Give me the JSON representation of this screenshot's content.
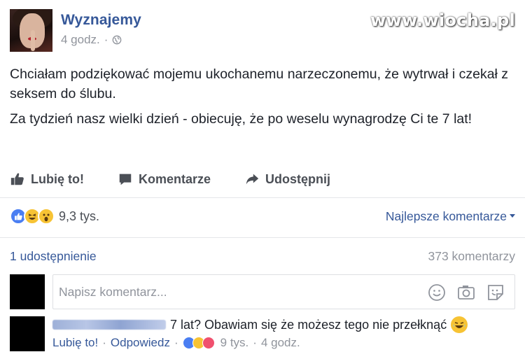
{
  "post": {
    "page_name": "Wyznajemy",
    "time": "4 godz.",
    "separator": "·",
    "paragraphs": [
      "Chciałam podziękować mojemu ukochanemu narzeczonemu, że wytrwał i czekał z seksem do ślubu.",
      "Za tydzień nasz wielki dzień - obiecuję, że po weselu wynagrodzę Ci te 7 lat!"
    ]
  },
  "watermark": "www.wiocha.pl",
  "actions": {
    "like": "Lubię to!",
    "comment": "Komentarze",
    "share": "Udostępnij"
  },
  "reactions": {
    "count": "9,3 tys.",
    "icons": [
      "like-icon",
      "haha-icon",
      "wow-icon"
    ],
    "sort_label": "Najlepsze komentarze"
  },
  "stats": {
    "shares": "1 udostępnienie",
    "comments": "373 komentarzy"
  },
  "composer": {
    "placeholder": "Napisz komentarz..."
  },
  "comment": {
    "text": "7 lat? Obawiam się że możesz tego nie przełknąć",
    "like_label": "Lubię to!",
    "reply_label": "Odpowiedz",
    "reaction_count": "9 tys.",
    "time": "4 godz.",
    "separator": "·"
  },
  "colors": {
    "link": "#365899",
    "muted": "#90949c",
    "text": "#1d2129",
    "like_blue": "#4a7ef2",
    "emoji_yellow": "#f7c334"
  }
}
